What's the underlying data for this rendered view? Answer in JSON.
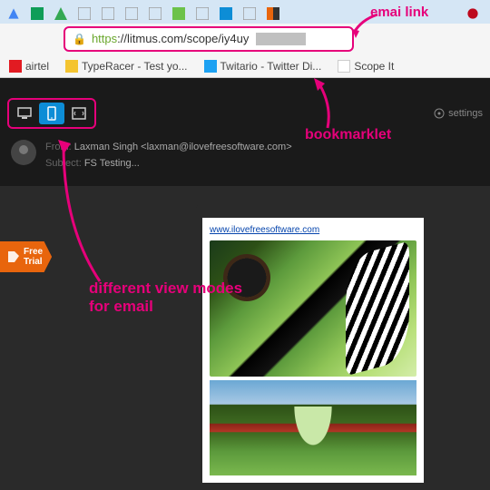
{
  "browser": {
    "url_https": "https",
    "url_rest": "://litmus.com/scope/iy4uy",
    "bookmarks": [
      {
        "label": "airtel"
      },
      {
        "label": "TypeRacer - Test yo..."
      },
      {
        "label": "Twitario - Twitter Di..."
      },
      {
        "label": "Scope It"
      }
    ]
  },
  "app": {
    "settings_label": "settings",
    "from_label": "From:",
    "from_value": "Laxman Singh <laxman@ilovefreesoftware.com>",
    "subject_label": "Subject:",
    "subject_value": "FS Testing...",
    "badge_line1": "Free",
    "badge_line2": "Trial",
    "preview_link": "www.ilovefreesoftware.com"
  },
  "annotations": {
    "email_link": "emai link",
    "bookmarklet": "bookmarklet",
    "view_modes_l1": "different view modes",
    "view_modes_l2": "for email"
  }
}
